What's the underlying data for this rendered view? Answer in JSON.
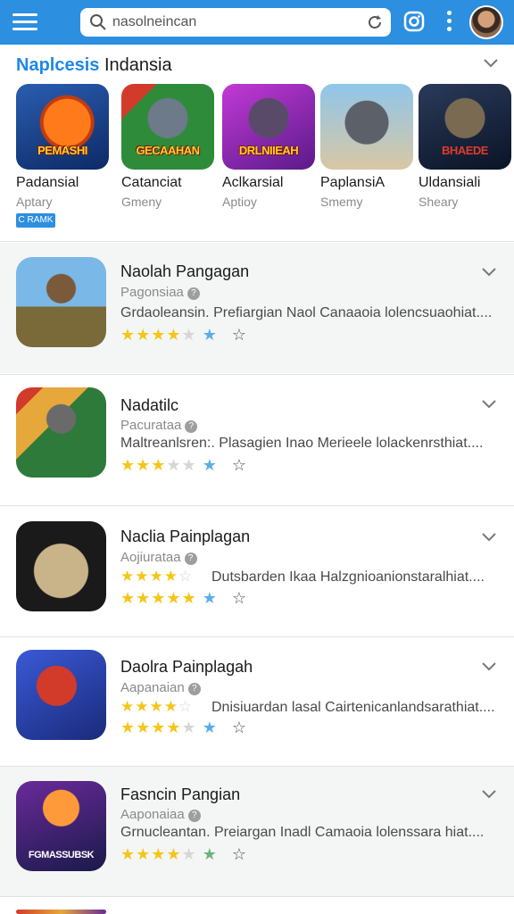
{
  "header": {
    "search_value": "nasolneincan"
  },
  "featured": {
    "title_accent": "Naplcesis",
    "title_rest": " Indansia",
    "badge": "C RAMK",
    "items": [
      {
        "name": "Padansial",
        "sub": "Aptary",
        "label": "PEMASHI"
      },
      {
        "name": "Catanciat",
        "sub": "Gmeny",
        "label": "GECAAHAN"
      },
      {
        "name": "Aclkarsial",
        "sub": "Aptioy",
        "label": "DRLNIIEAH"
      },
      {
        "name": "PaplansiA",
        "sub": "Smemy",
        "label": ""
      },
      {
        "name": "Uldansiali",
        "sub": "Sheary",
        "label": "BHAEDE"
      }
    ]
  },
  "list": [
    {
      "title": "Naolah Pangagan",
      "publisher": "Pagonsiaa",
      "desc": "Grdaoleansin.   Prefiargian Naol Canaaoia lolencsuaohiat....",
      "rating": "4"
    },
    {
      "title": "Nadatilc",
      "publisher": "Pacurataa",
      "desc": "Maltreanlsren:.  Plasagien Inao Merieele lolackenrsthiat....",
      "rating": "3"
    },
    {
      "title": "Naclia Painplagan",
      "publisher": "Aojiurataa",
      "desc": "Dutsbarden Ikaa Halzgnioanionstaralhiat....",
      "rating": "4"
    },
    {
      "title": "Daolra Painplagah",
      "publisher": "Aapanaian",
      "desc": "Dnisiuardan lasal Cairtenicanlandsarathiat....",
      "rating": "4"
    },
    {
      "title": "Fasncin Pangian",
      "publisher": "Aaponaiaa",
      "desc": "Grnucleantan.  Preiargan Inadl Camaoia lolenssara hiat....",
      "rating": "4"
    }
  ],
  "icon_fifth_label": "FGMASSUBSK",
  "colors": {
    "topbar": "#2d8fe0",
    "accent": "#1e88e5",
    "star": "#f5c518"
  }
}
